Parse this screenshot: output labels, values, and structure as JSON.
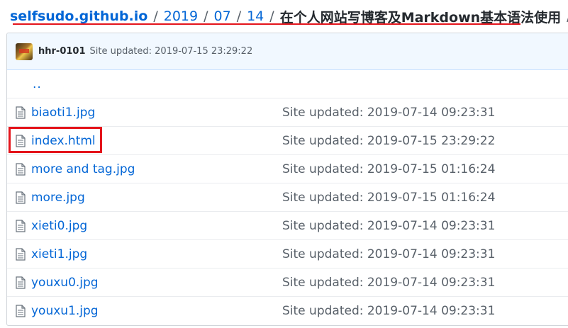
{
  "breadcrumb": {
    "repo": "selfsudo.github.io",
    "separator": "/",
    "seg1": "2019",
    "seg2": "07",
    "seg3": "14",
    "current": "在个人网站写博客及Markdown基本语法使用"
  },
  "commit": {
    "author": "hhr-0101",
    "message": "Site updated: 2019-07-15 23:29:22"
  },
  "parent_link": "..",
  "files": [
    {
      "name": "biaoti1.jpg",
      "updated": "Site updated: 2019-07-14 09:23:31"
    },
    {
      "name": "index.html",
      "updated": "Site updated: 2019-07-15 23:29:22"
    },
    {
      "name": "more and tag.jpg",
      "updated": "Site updated: 2019-07-15 01:16:24"
    },
    {
      "name": "more.jpg",
      "updated": "Site updated: 2019-07-15 01:16:24"
    },
    {
      "name": "xieti0.jpg",
      "updated": "Site updated: 2019-07-14 09:23:31"
    },
    {
      "name": "xieti1.jpg",
      "updated": "Site updated: 2019-07-14 09:23:31"
    },
    {
      "name": "youxu0.jpg",
      "updated": "Site updated: 2019-07-14 09:23:31"
    },
    {
      "name": "youxu1.jpg",
      "updated": "Site updated: 2019-07-14 09:23:31"
    }
  ],
  "icons": {
    "file": "file-icon",
    "avatar": "avatar"
  },
  "colors": {
    "link": "#0366d6",
    "annotation_red": "#e4141b",
    "commit_bar_bg": "#f1f8ff"
  }
}
